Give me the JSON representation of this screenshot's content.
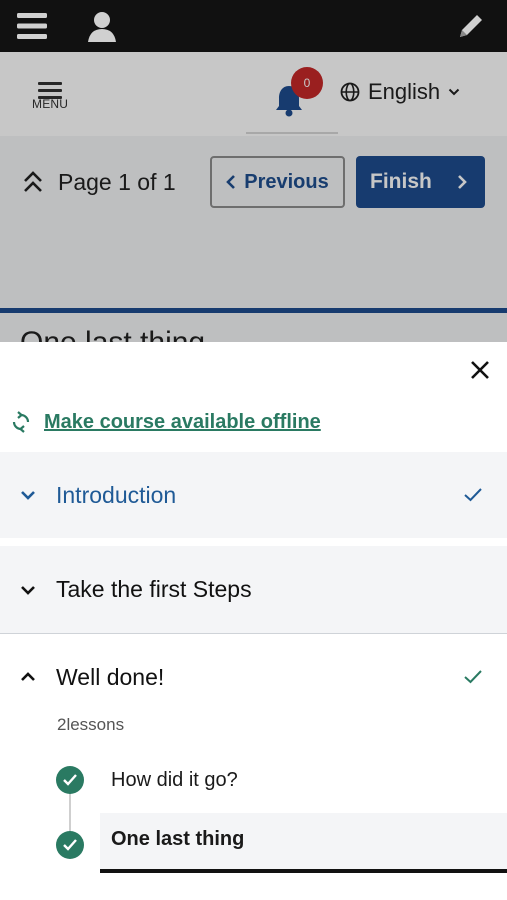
{
  "top_bar": {
    "icons": [
      "hamburger-icon",
      "user-icon",
      "pencil-icon"
    ]
  },
  "header": {
    "menu_label": "MENU",
    "notification_count": "0",
    "language": "English"
  },
  "page_nav": {
    "page_indicator": "Page 1 of 1",
    "previous_label": "Previous",
    "finish_label": "Finish"
  },
  "background_title": "One last thing",
  "sheet": {
    "offline_link": "Make course available offline",
    "sections": [
      {
        "title": "Introduction",
        "state": "collapsed",
        "completed": true,
        "accent": "#1f5a96"
      },
      {
        "title": "Take the first Steps",
        "state": "collapsed",
        "completed": false
      },
      {
        "title": "Well done!",
        "state": "expanded",
        "completed": true,
        "lessons_count": "2lessons",
        "lessons": [
          {
            "title": "How did it go?",
            "completed": true,
            "current": false
          },
          {
            "title": "One last thing",
            "completed": true,
            "current": true
          }
        ]
      }
    ]
  },
  "colors": {
    "brand_blue": "#1e4c8f",
    "success_green": "#2a7a62",
    "badge_red": "#c62828"
  }
}
